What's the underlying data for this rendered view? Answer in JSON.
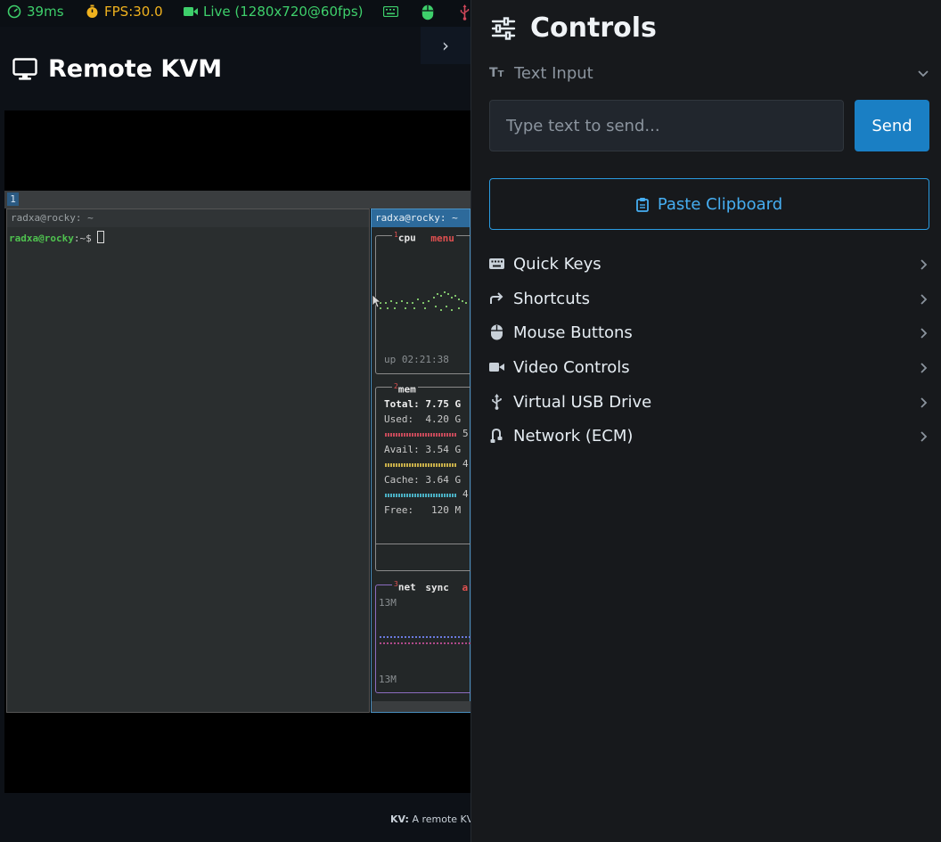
{
  "status_bar": {
    "latency": "39ms",
    "fps": "FPS:30.0",
    "live": "Live (1280x720@60fps)",
    "icons": [
      "speedometer-icon",
      "stopwatch-icon",
      "video-camera-icon",
      "keyboard-icon",
      "mouse-icon",
      "usb-icon"
    ],
    "colors": {
      "latency": "#3ecf6b",
      "fps": "#f0b21e",
      "live": "#3ecf6b",
      "keyboard": "#3ecf6b",
      "mouse": "#3ecf6b",
      "usb": "#d0475a"
    }
  },
  "header": {
    "title": "Remote KVM",
    "icon": "monitor-icon",
    "collapse_glyph": "›"
  },
  "video": {
    "workspace_tag": "1",
    "left_terminal": {
      "title": "radxa@rocky: ~",
      "prompt_user": "radxa@rocky",
      "prompt_path": ":~$ "
    },
    "right_terminal": {
      "title": "radxa@rocky: ~",
      "cpu_label": "cpu",
      "cpu_num": "1",
      "menu_label": "menu",
      "uptime": "up 02:21:38",
      "mem_num": "2",
      "mem_label": "mem",
      "total": "Total: 7.75 G",
      "used": "Used:  4.20 G",
      "used_pct": "5",
      "avail": "Avail: 3.54 G",
      "avail_pct": "4",
      "cache": "Cache: 3.64 G",
      "cache_pct": "4",
      "free": "Free:   120 M",
      "net_num": "3",
      "net_label": "net",
      "sync_label": "sync",
      "auto_label": "a",
      "net_top": "13M",
      "net_bottom": "13M"
    }
  },
  "footer": {
    "bold": "KV:",
    "text": "A remote KV"
  },
  "controls": {
    "title": "Controls",
    "text_input_section": "Text Input",
    "input_placeholder": "Type text to send...",
    "send_label": "Send",
    "paste_label": "Paste Clipboard",
    "sections": [
      {
        "label": "Quick Keys",
        "icon": "keyboard-icon"
      },
      {
        "label": "Shortcuts",
        "icon": "redirect-arrow-icon"
      },
      {
        "label": "Mouse Buttons",
        "icon": "mouse-icon"
      },
      {
        "label": "Video Controls",
        "icon": "video-camera-icon"
      },
      {
        "label": "Virtual USB Drive",
        "icon": "usb-icon"
      },
      {
        "label": "Network (ECM)",
        "icon": "network-icon"
      }
    ],
    "accent": "#1a7fc4"
  }
}
